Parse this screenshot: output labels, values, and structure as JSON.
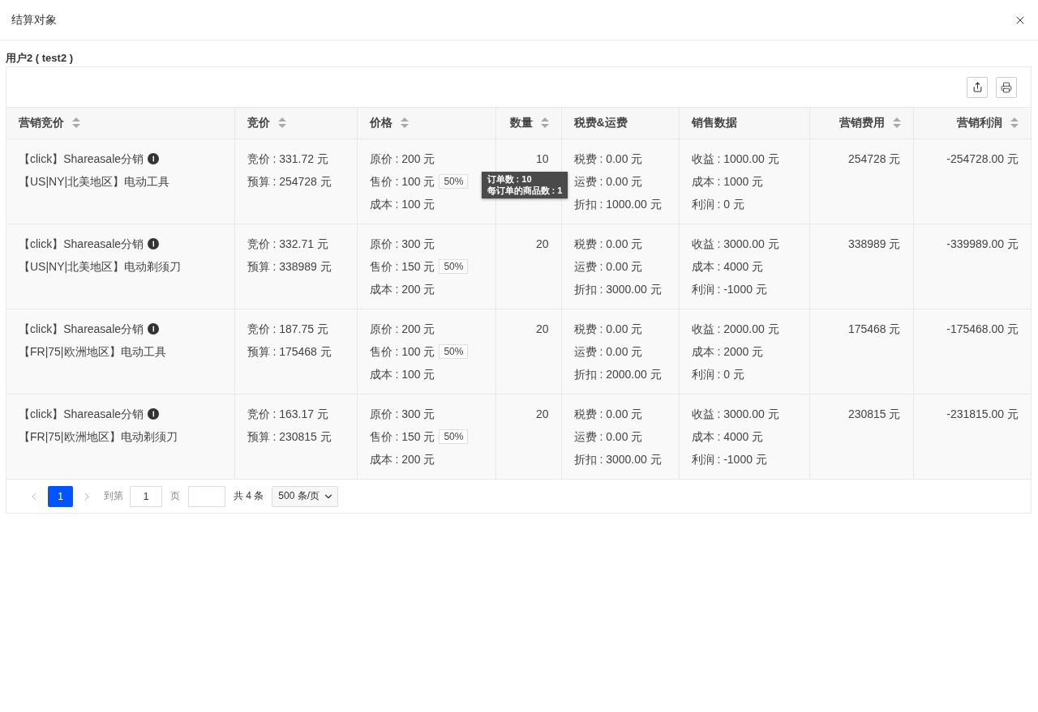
{
  "dialog": {
    "title": "结算对象"
  },
  "user_label": "用户2 ( test2 )",
  "table": {
    "columns": [
      {
        "label": "营销竞价",
        "sortable": true
      },
      {
        "label": "竞价",
        "sortable": true
      },
      {
        "label": "价格",
        "sortable": true
      },
      {
        "label": "数量",
        "sortable": true
      },
      {
        "label": "税费&运费",
        "sortable": false
      },
      {
        "label": "销售数据",
        "sortable": false
      },
      {
        "label": "营销费用",
        "sortable": true
      },
      {
        "label": "营销利润",
        "sortable": true
      }
    ],
    "rows": [
      {
        "campaign": [
          "【click】Shareasale分销",
          "【US|NY|北美地区】电动工具"
        ],
        "bid": [
          "竞价 : 331.72 元",
          "预算 : 254728 元"
        ],
        "price": [
          "原价 : 200 元",
          "售价 : 100 元",
          "成本 : 100 元"
        ],
        "discount_tag": "50%",
        "quantity": "10",
        "tax": [
          "税费 : 0.00 元",
          "运费 : 0.00 元",
          "折扣 : 1000.00 元"
        ],
        "sales": [
          "收益 : 1000.00 元",
          "成本 : 1000 元",
          "利润 : 0 元"
        ],
        "cost": "254728 元",
        "profit": "-254728.00 元",
        "tooltip": [
          "订单数 : 10",
          "每订单的商品数 : 1"
        ]
      },
      {
        "campaign": [
          "【click】Shareasale分销",
          "【US|NY|北美地区】电动剃须刀"
        ],
        "bid": [
          "竞价 : 332.71 元",
          "预算 : 338989 元"
        ],
        "price": [
          "原价 : 300 元",
          "售价 : 150 元",
          "成本 : 200 元"
        ],
        "discount_tag": "50%",
        "quantity": "20",
        "tax": [
          "税费 : 0.00 元",
          "运费 : 0.00 元",
          "折扣 : 3000.00 元"
        ],
        "sales": [
          "收益 : 3000.00 元",
          "成本 : 4000 元",
          "利润 : -1000 元"
        ],
        "cost": "338989 元",
        "profit": "-339989.00 元"
      },
      {
        "campaign": [
          "【click】Shareasale分销",
          "【FR|75|欧洲地区】电动工具"
        ],
        "bid": [
          "竞价 : 187.75 元",
          "预算 : 175468 元"
        ],
        "price": [
          "原价 : 200 元",
          "售价 : 100 元",
          "成本 : 100 元"
        ],
        "discount_tag": "50%",
        "quantity": "20",
        "tax": [
          "税费 : 0.00 元",
          "运费 : 0.00 元",
          "折扣 : 2000.00 元"
        ],
        "sales": [
          "收益 : 2000.00 元",
          "成本 : 2000 元",
          "利润 : 0 元"
        ],
        "cost": "175468 元",
        "profit": "-175468.00 元"
      },
      {
        "campaign": [
          "【click】Shareasale分销",
          "【FR|75|欧洲地区】电动剃须刀"
        ],
        "bid": [
          "竞价 : 163.17 元",
          "预算 : 230815 元"
        ],
        "price": [
          "原价 : 300 元",
          "售价 : 150 元",
          "成本 : 200 元"
        ],
        "discount_tag": "50%",
        "quantity": "20",
        "tax": [
          "税费 : 0.00 元",
          "运费 : 0.00 元",
          "折扣 : 3000.00 元"
        ],
        "sales": [
          "收益 : 3000.00 元",
          "成本 : 4000 元",
          "利润 : -1000 元"
        ],
        "cost": "230815 元",
        "profit": "-231815.00 元"
      }
    ]
  },
  "pagination": {
    "pages": [
      {
        "label": "1",
        "selected": true
      }
    ],
    "goto_label": "到第",
    "goto_value": "1",
    "page_unit": "页",
    "total": "共 4 条",
    "page_size": "500 条/页"
  }
}
